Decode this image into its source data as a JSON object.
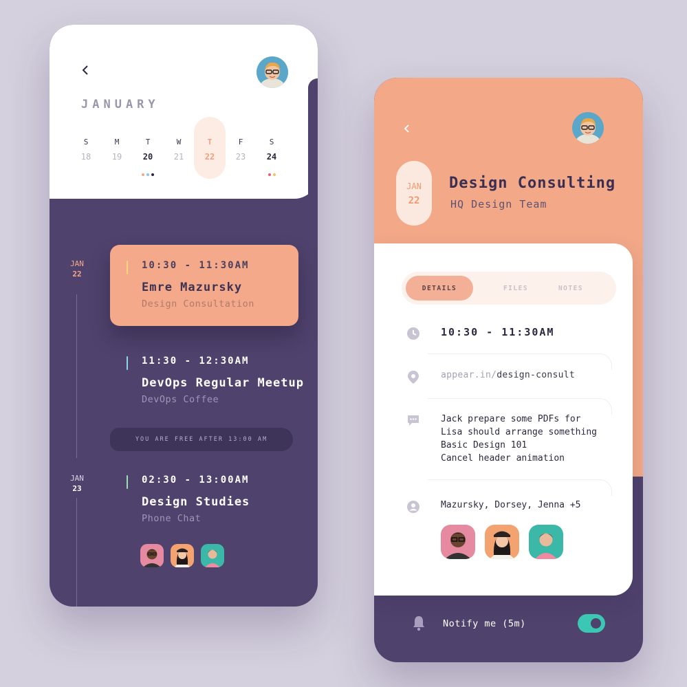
{
  "colors": {
    "background": "#d4d0dd",
    "purple": "#4f426c",
    "peach": "#f3a98a",
    "teal": "#3cc6b4",
    "dark_text": "#2d2840"
  },
  "calendar": {
    "month": "JANUARY",
    "days": [
      {
        "dow": "S",
        "num": "18"
      },
      {
        "dow": "M",
        "num": "19"
      },
      {
        "dow": "T",
        "num": "20"
      },
      {
        "dow": "W",
        "num": "21"
      },
      {
        "dow": "T",
        "num": "22"
      },
      {
        "dow": "F",
        "num": "23"
      },
      {
        "dow": "S",
        "num": "24"
      }
    ]
  },
  "timeline": {
    "date1": {
      "month": "JAN",
      "day": "22"
    },
    "date2": {
      "month": "JAN",
      "day": "23"
    },
    "events": [
      {
        "time": "10:30 - 11:30AM",
        "title": "Emre Mazursky",
        "subtitle": "Design Consultation"
      },
      {
        "time": "11:30 - 12:30AM",
        "title": "DevOps Regular Meetup",
        "subtitle": "DevOps Coffee"
      },
      {
        "time": "02:30 - 13:00AM",
        "title": "Design Studies",
        "subtitle": "Phone Chat"
      }
    ],
    "free_notice": "YOU ARE FREE AFTER 13:00 AM"
  },
  "detail": {
    "date": {
      "month": "JAN",
      "day": "22"
    },
    "title": "Design Consulting",
    "subtitle": "HQ Design Team",
    "tabs": [
      "DETAILS",
      "FILES",
      "NOTES"
    ],
    "time": "10:30 - 11:30AM",
    "link_host": "appear.in/",
    "link_path": "design-consult",
    "notes": [
      "Jack prepare some PDFs for",
      "Lisa should arrange something",
      "Basic Design 101",
      "Cancel header animation"
    ],
    "people": "Mazursky, Dorsey, Jenna +5",
    "notify": "Notify me (5m)"
  }
}
